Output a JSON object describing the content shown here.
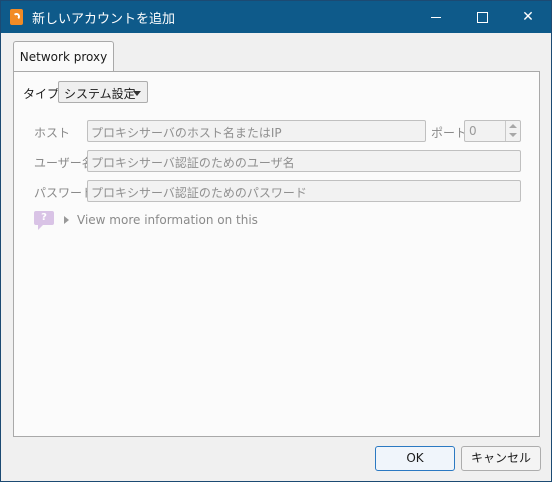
{
  "window": {
    "title": "新しいアカウントを追加"
  },
  "tabs": [
    {
      "label": "Network proxy"
    }
  ],
  "proxy": {
    "type_label": "タイプ",
    "type_value": "システム設定",
    "host_label": "ホスト",
    "host_placeholder": "プロキシサーバのホスト名またはIP",
    "port_label": "ポート",
    "port_value": "0",
    "username_label": "ユーザー名",
    "username_placeholder": "プロキシサーバ認証のためのユーザ名",
    "password_label": "パスワード",
    "password_placeholder": "プロキシサーバ認証のためのパスワード",
    "help_text": "View more information on this"
  },
  "buttons": {
    "ok": "OK",
    "cancel": "キャンセル"
  },
  "colors": {
    "titlebar": "#0e5a8a",
    "accent": "#2b79c2",
    "app_icon": "#f28b25"
  }
}
